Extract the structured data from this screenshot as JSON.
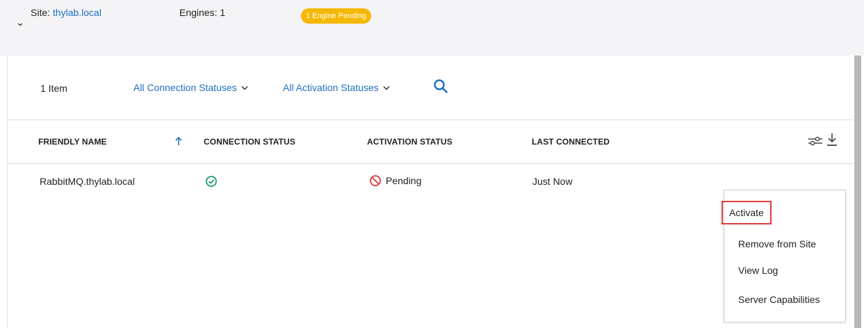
{
  "header": {
    "site_prefix": "Site: ",
    "site_name": "thylab.local",
    "engines": "Engines: 1",
    "pending_badge": "1 Engine Pending"
  },
  "toolbar": {
    "item_count": "1 Item",
    "connection_filter": "All Connection Statuses",
    "activation_filter": "All Activation Statuses"
  },
  "table": {
    "columns": [
      "FRIENDLY NAME",
      "CONNECTION STATUS",
      "ACTIVATION STATUS",
      "LAST CONNECTED"
    ],
    "sort": "ascending",
    "rows": [
      {
        "friendly_name": "RabbitMQ.thylab.local",
        "connection_status_icon": "check-circle-icon",
        "activation_status": "Pending",
        "activation_status_icon": "prohibited-icon",
        "last_connected": "Just Now"
      }
    ]
  },
  "context_menu": {
    "items": [
      "Activate",
      "Remove from Site",
      "View Log",
      "Server Capabilities"
    ],
    "highlighted": "Activate"
  },
  "colors": {
    "link": "#1e6fc1",
    "badge": "#f5b800",
    "success": "#1e9c6e",
    "danger": "#d93a3a",
    "highlight": "#e23b3b"
  }
}
